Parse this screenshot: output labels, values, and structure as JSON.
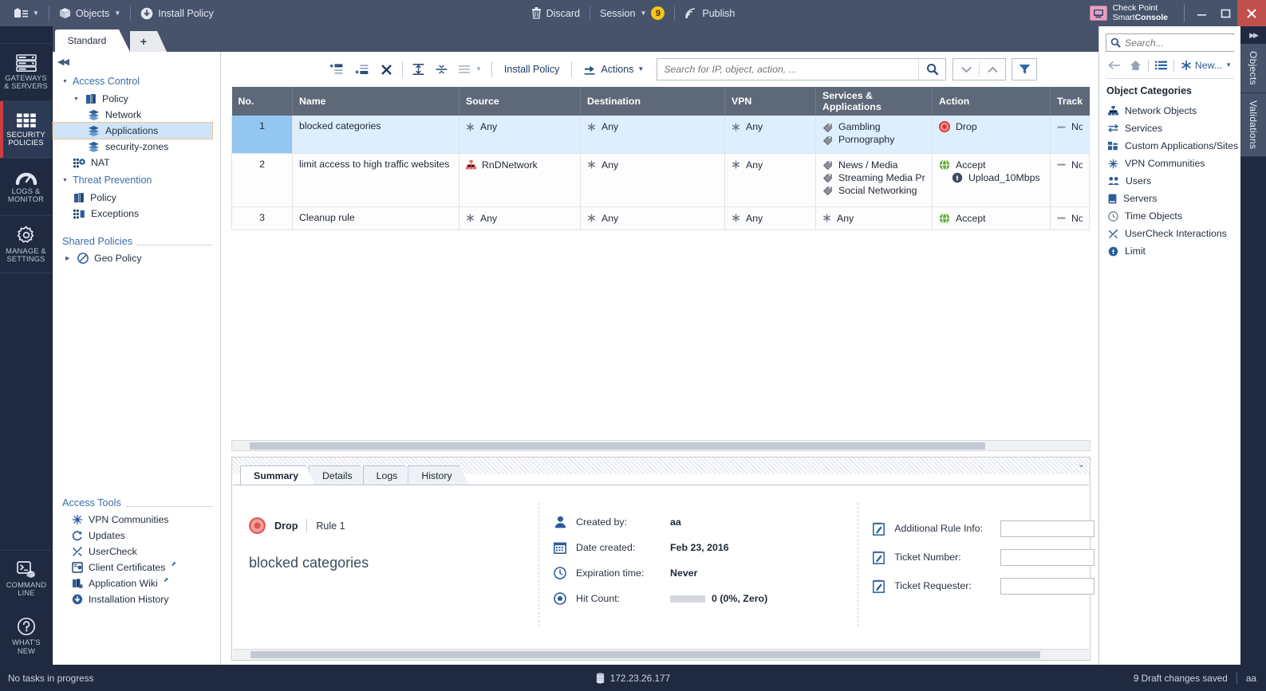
{
  "topbar": {
    "menu_icon": "app-menu-icon",
    "objects_label": "Objects",
    "install_policy_label": "Install Policy",
    "discard_label": "Discard",
    "session_label": "Session",
    "session_count": "9",
    "publish_label": "Publish",
    "brand_line1": "Check Point",
    "brand_line2_normal": "Smart",
    "brand_line2_bold": "Console",
    "minimize": "–",
    "maximize": "☐",
    "close": "✕"
  },
  "rail": {
    "items": [
      {
        "name": "gateways-servers",
        "icon": "servers-icon",
        "line1": "GATEWAYS",
        "line2": "& SERVERS",
        "active": false
      },
      {
        "name": "security-policies",
        "icon": "grid-icon",
        "line1": "SECURITY",
        "line2": "POLICIES",
        "active": true
      },
      {
        "name": "logs-monitor",
        "icon": "gauge-icon",
        "line1": "LOGS &",
        "line2": "MONITOR",
        "active": false
      },
      {
        "name": "manage-settings",
        "icon": "gear-icon",
        "line1": "MANAGE &",
        "line2": "SETTINGS",
        "active": false
      }
    ],
    "bottom_items": [
      {
        "name": "command-line",
        "icon": "terminal-icon",
        "line1": "COMMAND",
        "line2": "LINE"
      },
      {
        "name": "whats-new",
        "icon": "question-icon",
        "line1": "WHAT'S",
        "line2": "NEW"
      }
    ]
  },
  "tabstrip": {
    "policy_tab": "Standard",
    "new_tab": "+"
  },
  "nav": {
    "collapse_icon": "collapse-left-icon",
    "access_control": "Access Control",
    "policy": "Policy",
    "children": [
      {
        "label": "Network",
        "icon": "layers-icon",
        "selected": false
      },
      {
        "label": "Applications",
        "icon": "layers-icon",
        "selected": true
      },
      {
        "label": "security-zones",
        "icon": "layers-icon",
        "selected": false
      }
    ],
    "nat": "NAT",
    "threat_prevention": "Threat Prevention",
    "tp_policy": "Policy",
    "tp_exceptions": "Exceptions",
    "shared_policies": "Shared Policies",
    "geo_policy": "Geo Policy",
    "access_tools_title": "Access Tools",
    "access_tools": [
      {
        "label": "VPN Communities",
        "icon": "vpn-icon",
        "external": false
      },
      {
        "label": "Updates",
        "icon": "refresh-icon",
        "external": false
      },
      {
        "label": "UserCheck",
        "icon": "usercheck-icon",
        "external": false
      },
      {
        "label": "Client Certificates",
        "icon": "certificate-icon",
        "external": true
      },
      {
        "label": "Application Wiki",
        "icon": "wiki-icon",
        "external": true
      },
      {
        "label": "Installation History",
        "icon": "download-icon",
        "external": false
      }
    ]
  },
  "toolbar": {
    "add_rule_above": "add-rule-above-icon",
    "add_rule_below": "add-rule-below-icon",
    "delete_rule": "delete-rule-icon",
    "expand_all": "expand-all-icon",
    "collapse_all": "collapse-all-icon",
    "list_menu": "list-menu-icon",
    "install_policy": "Install Policy",
    "actions": "Actions",
    "search_placeholder": "Search for IP, object, action, ...",
    "search_value": "",
    "search_icon": "search-icon",
    "prev_icon": "chevron-down-icon",
    "next_icon": "chevron-up-icon",
    "filter_icon": "filter-icon"
  },
  "rules_table": {
    "columns": [
      "No.",
      "Name",
      "Source",
      "Destination",
      "VPN",
      "Services & Applications",
      "Action",
      "Track"
    ],
    "rows": [
      {
        "no": "1",
        "name": "blocked categories",
        "source": [
          {
            "icon": "any-asterisk-icon",
            "label": "Any"
          }
        ],
        "destination": [
          {
            "icon": "any-asterisk-icon",
            "label": "Any"
          }
        ],
        "vpn": [
          {
            "icon": "any-asterisk-icon",
            "label": "Any"
          }
        ],
        "services": [
          {
            "icon": "application-tag-icon",
            "label": "Gambling"
          },
          {
            "icon": "application-tag-icon",
            "label": "Pornography"
          }
        ],
        "action": [
          {
            "icon": "drop-icon",
            "label": "Drop",
            "sub": false
          }
        ],
        "track": [
          {
            "icon": "none-dash-icon",
            "label": "None"
          }
        ],
        "selected": true
      },
      {
        "no": "2",
        "name": "limit access to high traffic websites",
        "source": [
          {
            "icon": "network-object-icon",
            "label": "RnDNetwork"
          }
        ],
        "destination": [
          {
            "icon": "any-asterisk-icon",
            "label": "Any"
          }
        ],
        "vpn": [
          {
            "icon": "any-asterisk-icon",
            "label": "Any"
          }
        ],
        "services": [
          {
            "icon": "application-tag-icon",
            "label": "News / Media"
          },
          {
            "icon": "application-tag-icon",
            "label": "Streaming Media Pr..."
          },
          {
            "icon": "application-tag-icon",
            "label": "Social Networking"
          }
        ],
        "action": [
          {
            "icon": "accept-icon",
            "label": "Accept",
            "sub": false
          },
          {
            "icon": "limit-icon",
            "label": "Upload_10Mbps",
            "sub": true
          }
        ],
        "track": [
          {
            "icon": "none-dash-icon",
            "label": "None"
          }
        ],
        "selected": false
      },
      {
        "no": "3",
        "name": "Cleanup rule",
        "source": [
          {
            "icon": "any-asterisk-icon",
            "label": "Any"
          }
        ],
        "destination": [
          {
            "icon": "any-asterisk-icon",
            "label": "Any"
          }
        ],
        "vpn": [
          {
            "icon": "any-asterisk-icon",
            "label": "Any"
          }
        ],
        "services": [
          {
            "icon": "any-asterisk-icon",
            "label": "Any"
          }
        ],
        "action": [
          {
            "icon": "accept-icon",
            "label": "Accept",
            "sub": false
          }
        ],
        "track": [
          {
            "icon": "none-dash-icon",
            "label": "None"
          }
        ],
        "selected": false
      }
    ]
  },
  "details_panel": {
    "tabs": [
      {
        "label": "Summary",
        "active": true
      },
      {
        "label": "Details",
        "active": false
      },
      {
        "label": "Logs",
        "active": false
      },
      {
        "label": "History",
        "active": false
      }
    ],
    "expand_icon": "chevron-expand-icon",
    "summary": {
      "action_icon": "drop-icon",
      "action_label": "Drop",
      "rule_label": "Rule 1",
      "rule_name": "blocked categories",
      "fields": [
        {
          "icon": "user-icon",
          "key": "Created by:",
          "value": "aa"
        },
        {
          "icon": "calendar-icon",
          "key": "Date created:",
          "value": "Feb 23, 2016"
        },
        {
          "icon": "clock-icon",
          "key": "Expiration time:",
          "value": "Never"
        },
        {
          "icon": "hitcount-icon",
          "key": "Hit Count:",
          "value": "0 (0%, Zero)",
          "has_bar": true
        }
      ],
      "inputs": [
        {
          "icon": "note-icon",
          "key": "Additional Rule Info:",
          "value": "",
          "name": "additional-rule-info-input"
        },
        {
          "icon": "note-icon",
          "key": "Ticket Number:",
          "value": "",
          "name": "ticket-number-input"
        },
        {
          "icon": "note-icon",
          "key": "Ticket Requester:",
          "value": "",
          "name": "ticket-requester-input"
        }
      ]
    }
  },
  "objects_panel": {
    "search_placeholder": "Search...",
    "search_value": "",
    "back_icon": "arrow-left-icon",
    "home_icon": "home-icon",
    "list_icon": "list-icon",
    "new_label": "New...",
    "categories_title": "Object Categories",
    "categories": [
      {
        "label": "Network Objects",
        "icon": "network-object-icon"
      },
      {
        "label": "Services",
        "icon": "services-icon"
      },
      {
        "label": "Custom Applications/Sites",
        "icon": "custom-apps-icon"
      },
      {
        "label": "VPN Communities",
        "icon": "vpn-icon"
      },
      {
        "label": "Users",
        "icon": "users-icon"
      },
      {
        "label": "Servers",
        "icon": "server-icon"
      },
      {
        "label": "Time Objects",
        "icon": "clock-icon"
      },
      {
        "label": "UserCheck Interactions",
        "icon": "usercheck-icon"
      },
      {
        "label": "Limit",
        "icon": "limit-icon"
      }
    ]
  },
  "vertical_tabs": {
    "collapse_icon": "collapse-right-icon",
    "tabs": [
      "Objects",
      "Validations"
    ]
  },
  "statusbar": {
    "tasks": "No tasks in progress",
    "server_icon": "database-icon",
    "server_ip": "172.23.26.177",
    "draft_changes": "9 Draft changes saved",
    "user": "aa"
  },
  "colors": {
    "topbar": "#46536b",
    "rail": "#1f2a40",
    "accent_blue": "#2b5d9b",
    "accent_red": "#cf3d3d",
    "drop_red": "#e8504f",
    "accept_green": "#4aa832",
    "selection": "#ddeeff",
    "session_badge": "#f5c518"
  }
}
